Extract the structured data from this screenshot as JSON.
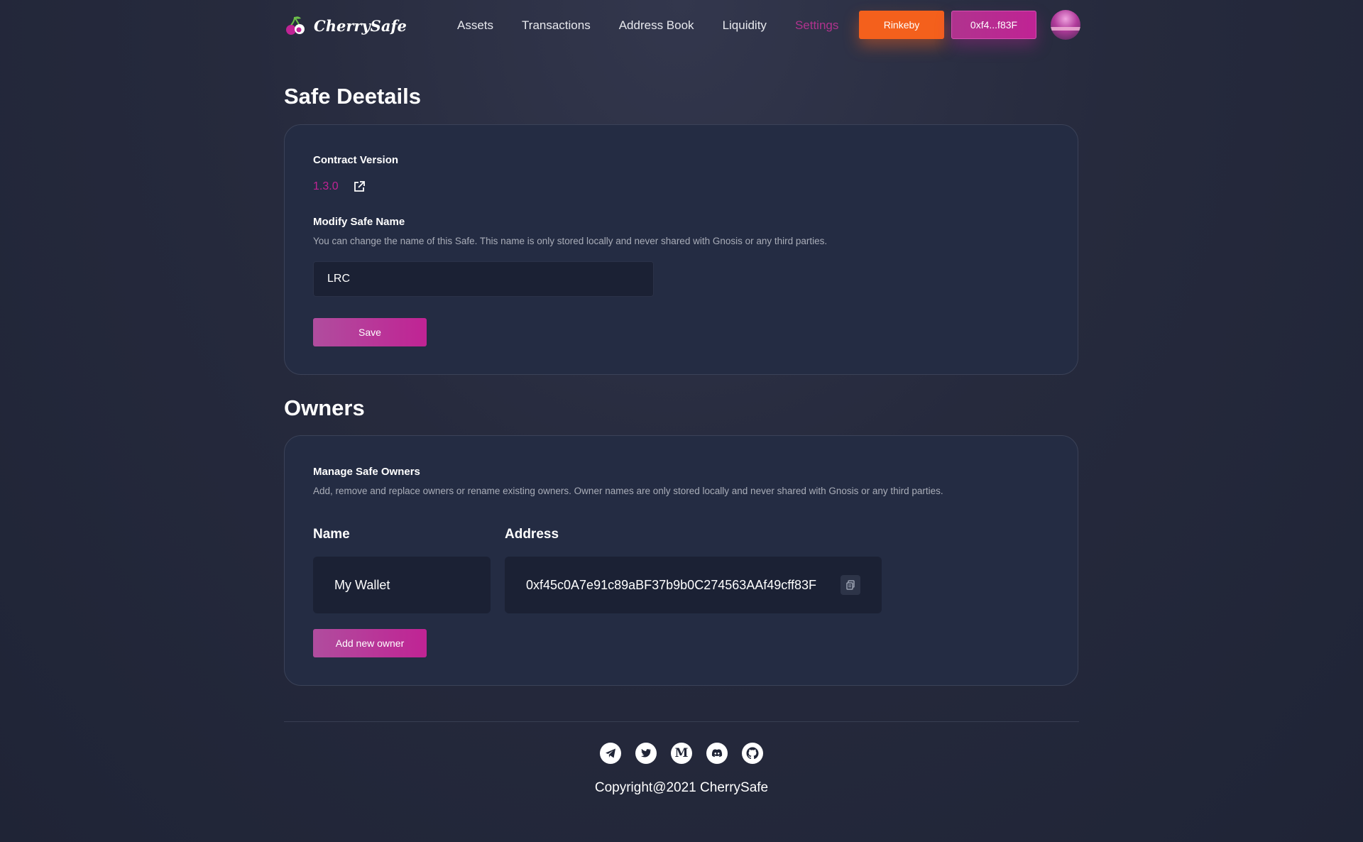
{
  "header": {
    "brand": "CherrySafe",
    "nav": [
      {
        "label": "Assets"
      },
      {
        "label": "Transactions"
      },
      {
        "label": "Address Book"
      },
      {
        "label": "Liquidity"
      },
      {
        "label": "Settings"
      }
    ],
    "active_nav": "Settings",
    "network_label": "Rinkeby",
    "account_label": "0xf4...f83F"
  },
  "safe_details": {
    "title": "Safe Deetails",
    "contract_version_label": "Contract Version",
    "contract_version": "1.3.0",
    "modify_name_label": "Modify Safe Name",
    "modify_name_desc": "You can change the name of this Safe. This name is only stored locally and never shared with Gnosis or any third parties.",
    "name_value": "LRC",
    "save_label": "Save"
  },
  "owners": {
    "title": "Owners",
    "manage_label": "Manage Safe Owners",
    "manage_desc": "Add, remove and replace owners or rename existing owners. Owner names are only stored locally and never shared with Gnosis or any third parties.",
    "col_name": "Name",
    "col_address": "Address",
    "rows": [
      {
        "name": "My Wallet",
        "address": "0xf45c0A7e91c89aBF37b9b0C274563AAf49cff83F"
      }
    ],
    "add_label": "Add new owner"
  },
  "footer": {
    "socials": [
      "telegram-icon",
      "twitter-icon",
      "medium-icon",
      "discord-icon",
      "github-icon"
    ],
    "copyright": "Copyright@2021 CherrySafe"
  },
  "colors": {
    "accent_pink": "#c02394",
    "network_orange": "#f4601c",
    "card_bg": "#242c43",
    "input_bg": "#1b2134"
  }
}
